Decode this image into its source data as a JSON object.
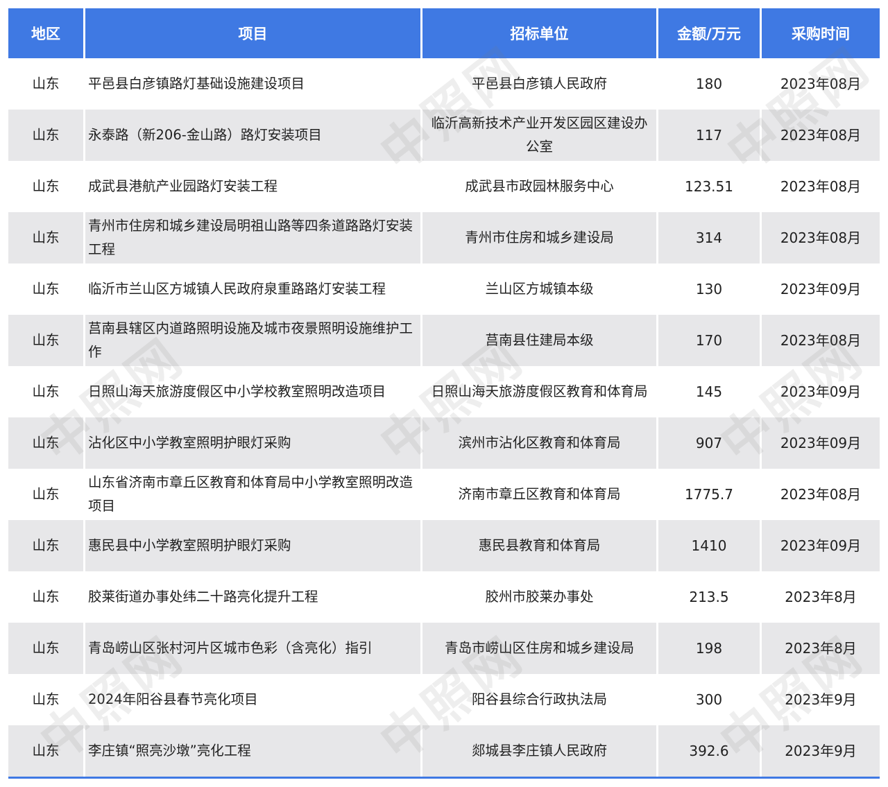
{
  "table": {
    "headers": {
      "region": "地区",
      "project": "项目",
      "unit": "招标单位",
      "amount": "金额/万元",
      "time": "采购时间"
    },
    "rows": [
      {
        "region": "山东",
        "project": "平邑县白彦镇路灯基础设施建设项目",
        "unit": "平邑县白彦镇人民政府",
        "amount": "180",
        "time": "2023年08月"
      },
      {
        "region": "山东",
        "project": "永泰路（新206-金山路）路灯安装项目",
        "unit": "临沂高新技术产业开发区园区建设办公室",
        "amount": "117",
        "time": "2023年08月"
      },
      {
        "region": "山东",
        "project": "成武县港航产业园路灯安装工程",
        "unit": "成武县市政园林服务中心",
        "amount": "123.51",
        "time": "2023年08月"
      },
      {
        "region": "山东",
        "project": "青州市住房和城乡建设局明祖山路等四条道路路灯安装工程",
        "unit": "青州市住房和城乡建设局",
        "amount": "314",
        "time": "2023年08月"
      },
      {
        "region": "山东",
        "project": "临沂市兰山区方城镇人民政府泉重路路灯安装工程",
        "unit": "兰山区方城镇本级",
        "amount": "130",
        "time": "2023年09月"
      },
      {
        "region": "山东",
        "project": "莒南县辖区内道路照明设施及城市夜景照明设施维护工作",
        "unit": "莒南县住建局本级",
        "amount": "170",
        "time": "2023年08月"
      },
      {
        "region": "山东",
        "project": "日照山海天旅游度假区中小学校教室照明改造项目",
        "unit": "日照山海天旅游度假区教育和体育局",
        "amount": "145",
        "time": "2023年09月"
      },
      {
        "region": "山东",
        "project": "沾化区中小学教室照明护眼灯采购",
        "unit": "滨州市沾化区教育和体育局",
        "amount": "907",
        "time": "2023年09月"
      },
      {
        "region": "山东",
        "project": "山东省济南市章丘区教育和体育局中小学教室照明改造项目",
        "unit": "济南市章丘区教育和体育局",
        "amount": "1775.7",
        "time": "2023年08月"
      },
      {
        "region": "山东",
        "project": "惠民县中小学教室照明护眼灯采购",
        "unit": "惠民县教育和体育局",
        "amount": "1410",
        "time": "2023年09月"
      },
      {
        "region": "山东",
        "project": "胶莱街道办事处纬二十路亮化提升工程",
        "unit": "胶州市胶莱办事处",
        "amount": "213.5",
        "time": "2023年8月"
      },
      {
        "region": "山东",
        "project": "青岛崂山区张村河片区城市色彩（含亮化）指引",
        "unit": "青岛市崂山区住房和城乡建设局",
        "amount": "198",
        "time": "2023年8月"
      },
      {
        "region": "山东",
        "project": "2024年阳谷县春节亮化项目",
        "unit": "阳谷县综合行政执法局",
        "amount": "300",
        "time": "2023年9月"
      },
      {
        "region": "山东",
        "project": "李庄镇“照亮沙墩”亮化工程",
        "unit": "郯城县李庄镇人民政府",
        "amount": "392.6",
        "time": "2023年9月"
      }
    ]
  },
  "watermark": {
    "text": "中照网"
  }
}
